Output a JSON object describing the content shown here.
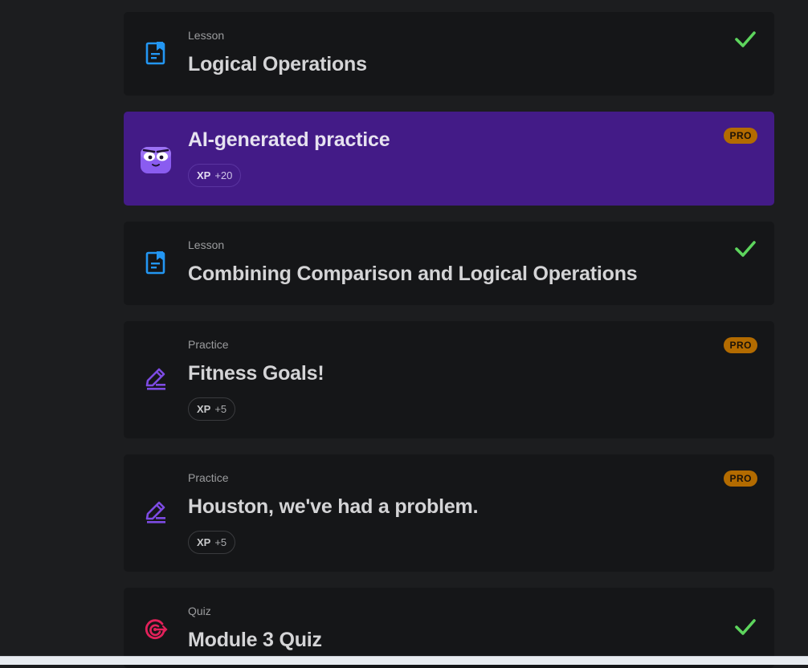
{
  "colors": {
    "page_bg": "#1c1d1f",
    "card_bg": "#151618",
    "ai_card_bg": "#431b87",
    "lesson_icon": "#2396f2",
    "practice_icon": "#7d4be3",
    "quiz_icon": "#e2215a",
    "check": "#5dd55d",
    "pro_badge": "#b36b00"
  },
  "items": [
    {
      "type": "Lesson",
      "title": "Logical Operations",
      "icon": "lesson-document-icon",
      "completed": true
    },
    {
      "type": "",
      "title": "AI-generated practice",
      "icon": "ai-bot-icon",
      "xp_label": "XP",
      "xp_value": "+20",
      "badge": "PRO"
    },
    {
      "type": "Lesson",
      "title": "Combining Comparison and Logical Operations",
      "icon": "lesson-document-icon",
      "completed": true
    },
    {
      "type": "Practice",
      "title": "Fitness Goals!",
      "icon": "pencil-edit-icon",
      "xp_label": "XP",
      "xp_value": "+5",
      "badge": "PRO"
    },
    {
      "type": "Practice",
      "title": "Houston, we've had a problem.",
      "icon": "pencil-edit-icon",
      "xp_label": "XP",
      "xp_value": "+5",
      "badge": "PRO"
    },
    {
      "type": "Quiz",
      "title": "Module 3 Quiz",
      "icon": "target-icon",
      "completed": true
    }
  ]
}
